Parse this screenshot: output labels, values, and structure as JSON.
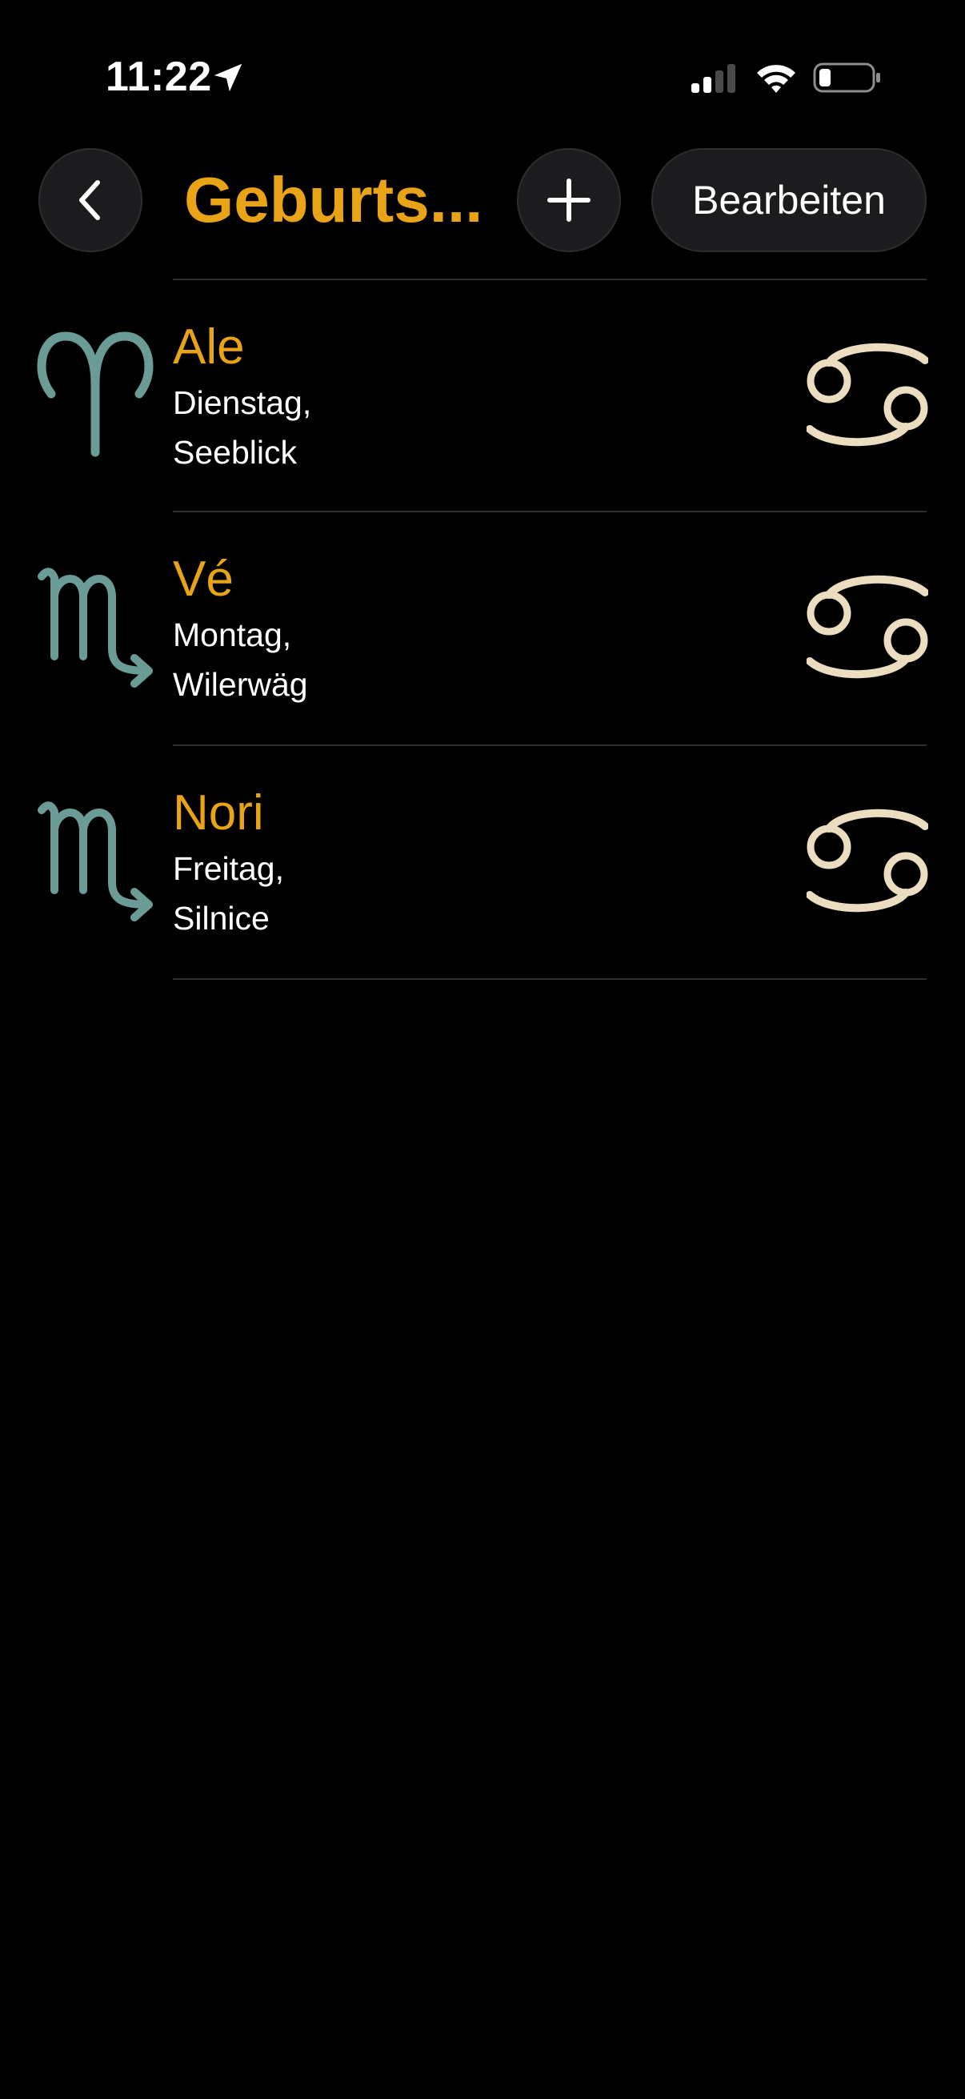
{
  "status_bar": {
    "time": "11:22"
  },
  "nav": {
    "title": "Geburts...",
    "edit_label": "Bearbeiten"
  },
  "icons": {
    "back": "chevron-left-icon",
    "add": "plus-icon",
    "location": "location-arrow-icon",
    "signal": "cellular-signal-icon",
    "wifi": "wifi-icon",
    "battery": "battery-icon",
    "aries": "aries-icon",
    "scorpio": "scorpio-icon",
    "cancer": "cancer-icon"
  },
  "colors": {
    "background": "#000000",
    "accent": "#e8a317",
    "zodiac_left": "#6a9b96",
    "zodiac_right": "#ecdcc0",
    "button_bg": "#1c1c1e"
  },
  "entries": [
    {
      "name": "Ale",
      "line1": "Dienstag,",
      "line2": "Seeblick",
      "sign_left": "aries",
      "sign_right": "cancer"
    },
    {
      "name": "Vé",
      "line1": "Montag,",
      "line2": "Wilerwäg",
      "sign_left": "scorpio",
      "sign_right": "cancer"
    },
    {
      "name": "Nori",
      "line1": "Freitag,",
      "line2": "Silnice",
      "sign_left": "scorpio",
      "sign_right": "cancer"
    }
  ]
}
